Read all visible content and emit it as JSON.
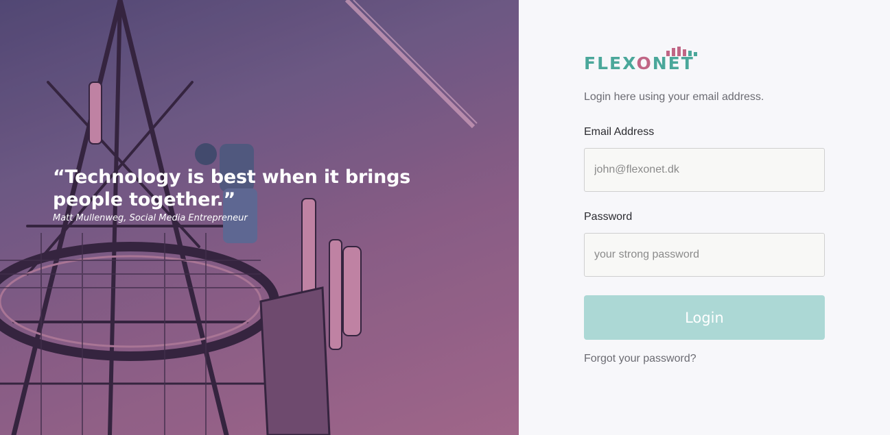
{
  "hero": {
    "quote": "“Technology is best when it brings people together.”",
    "author": "Matt Mullenweg, Social Media Entrepreneur"
  },
  "brand": {
    "name_part1": "FLEX",
    "name_o": "O",
    "name_part2": "NET",
    "primary_color": "#4aa79a",
    "accent_color": "#c06585"
  },
  "login": {
    "intro": "Login here using your email address.",
    "email_label": "Email Address",
    "email_placeholder": "john@flexonet.dk",
    "password_label": "Password",
    "password_placeholder": "your strong password",
    "button_label": "Login",
    "button_color": "#acd8d5",
    "forgot_link": "Forgot your password?"
  }
}
